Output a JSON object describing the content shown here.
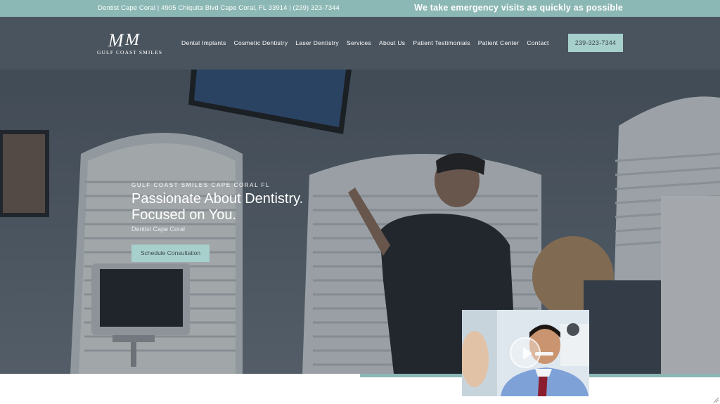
{
  "topbar": {
    "address": "Dentist Cape Coral | 4905 Chiquita Blvd Cape Coral, FL 33914 | (239) 323-7344",
    "emergency": "We take emergency visits as quickly as possible"
  },
  "header": {
    "logo_mark": "MM",
    "logo_text": "GULF COAST SMILES",
    "nav": [
      "Dental Implants",
      "Cosmetic Dentistry",
      "Laser Dentistry",
      "Services",
      "About Us",
      "Patient Testimonials",
      "Patient Center",
      "Contact"
    ],
    "phone": "239-323-7344"
  },
  "hero": {
    "eyebrow": "GULF COAST SMILES CAPE CORAL FL",
    "headline_line1": "Passionate About Dentistry.",
    "headline_line2": "Focused on You.",
    "sub": "Dentist Cape Coral",
    "cta": "Schedule Consultation"
  },
  "colors": {
    "accent": "#8bb7b4",
    "button": "#a7cfcc",
    "header_bg": "#4a545e"
  }
}
